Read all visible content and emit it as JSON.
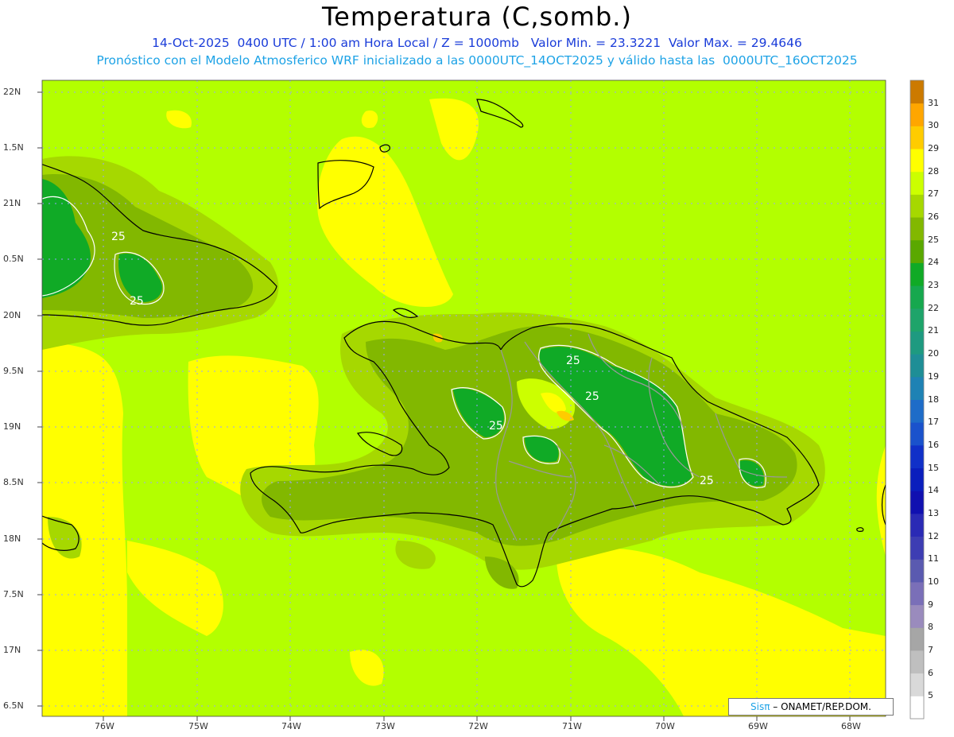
{
  "header": {
    "title": "Temperatura (C,somb.)",
    "line1": "14-Oct-2025  0400 UTC / 1:00 am Hora Local / Z = 1000mb   Valor Min. = 23.3221  Valor Max. = 29.4646",
    "line2": "Pronóstico con el Modelo Atmosferico WRF inicializado a las 0000UTC_14OCT2025 y válido hasta las  0000UTC_16OCT2025"
  },
  "axes": {
    "lat_labels": [
      "22N",
      "1.5N",
      "21N",
      "0.5N",
      "20N",
      "9.5N",
      "19N",
      "8.5N",
      "18N",
      "7.5N",
      "17N",
      "6.5N"
    ],
    "lon_labels": [
      "76W",
      "75W",
      "74W",
      "73W",
      "72W",
      "71W",
      "70W",
      "69W",
      "68W"
    ]
  },
  "colorbar": {
    "levels": [
      "5",
      "6",
      "7",
      "8",
      "9",
      "10",
      "11",
      "12",
      "13",
      "14",
      "15",
      "16",
      "17",
      "18",
      "19",
      "20",
      "21",
      "22",
      "23",
      "24",
      "25",
      "26",
      "27",
      "28",
      "29",
      "30",
      "31"
    ],
    "colors": [
      "#ffffff",
      "#d9d9d9",
      "#bfbfbf",
      "#a6a6a6",
      "#9a8bbd",
      "#7a6fb8",
      "#5a5ab0",
      "#3d3db3",
      "#2a2ab5",
      "#1010b0",
      "#0a1ebd",
      "#1030c8",
      "#1a52cc",
      "#1e6cc8",
      "#1e82b4",
      "#1e8e96",
      "#1e9a80",
      "#1ea46a",
      "#16a84e",
      "#10aa26",
      "#5aa800",
      "#82b800",
      "#a6d800",
      "#ccff00",
      "#ffff00",
      "#ffcc00",
      "#ffa600",
      "#cc7a00"
    ]
  },
  "contour_labels": [
    "25",
    "25",
    "25",
    "25",
    "25",
    "25"
  ],
  "credit": {
    "logo": "Sisπ",
    "text": "– ONAMET/REP.DOM."
  }
}
